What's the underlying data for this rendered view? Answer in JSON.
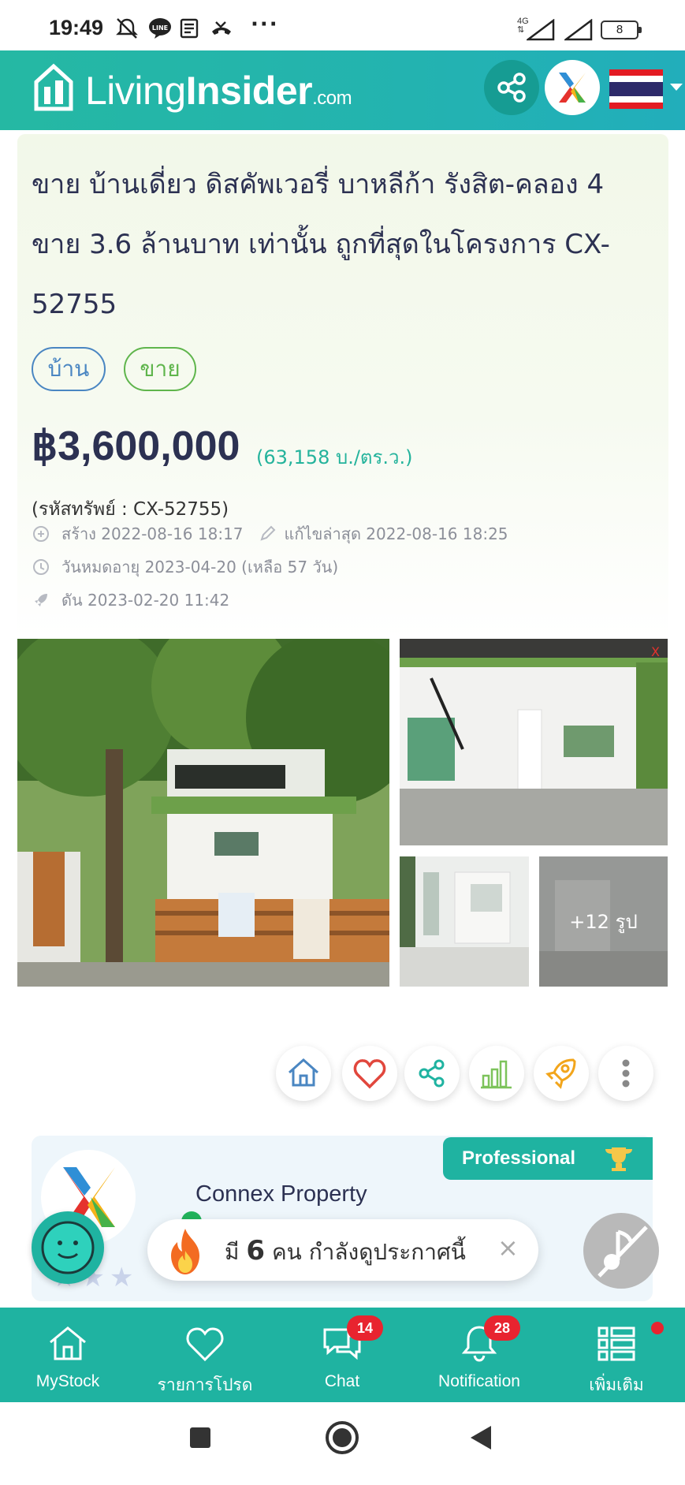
{
  "status_bar": {
    "time": "19:49",
    "more": "···",
    "network": "4G",
    "battery": "8"
  },
  "header": {
    "logo_living": "Living",
    "logo_insider": "Insider",
    "logo_domain": ".com",
    "share_icon": "share-icon",
    "language": "Thai flag"
  },
  "listing": {
    "title": "ขาย บ้านเดี่ยว ดิสคัพเวอรี่ บาหลีก้า รังสิต-คลอง 4 ขาย 3.6 ล้านบาท เท่านั้น ถูกที่สุดในโครงการ CX-52755",
    "tags": [
      "บ้าน",
      "ขาย"
    ],
    "price": "฿3,600,000",
    "price_per_unit": "(63,158 บ./ตร.ว.)",
    "asset_code": "(รหัสทรัพย์ : CX-52755)",
    "created": "สร้าง 2022-08-16 18:17",
    "edited": "แก้ไขล่าสุด 2022-08-16 18:25",
    "expiry": "วันหมดอายุ 2023-04-20  (เหลือ 57 วัน)",
    "boosted": "ดัน 2023-02-20 11:42",
    "more_photos": "+12 รูป"
  },
  "agent": {
    "name": "Connex Property",
    "badge": "Professional",
    "stars": "★★★"
  },
  "viewers": {
    "prefix": "มี",
    "count": "6",
    "suffix": "คน กำลังดูประกาศนี้",
    "close": "×"
  },
  "bottom_nav": {
    "mystock": "MyStock",
    "favorites": "รายการโปรด",
    "chat": "Chat",
    "chat_badge": "14",
    "notification": "Notification",
    "notification_badge": "28",
    "more": "เพิ่มเติม"
  },
  "colors": {
    "brand_teal": "#1fb3a1",
    "price_text": "#2c3152",
    "badge_red": "#e8242f"
  }
}
